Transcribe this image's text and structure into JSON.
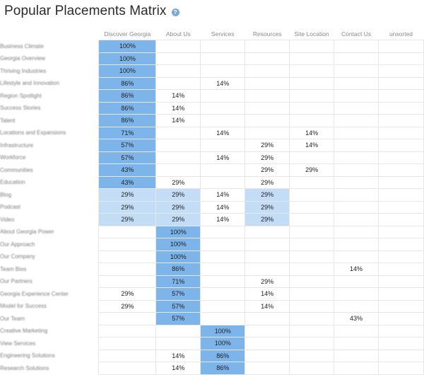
{
  "header": {
    "title": "Popular Placements Matrix",
    "help_icon": "?"
  },
  "colors": {
    "strong": "#7db4ea",
    "light": "#c4ddf7",
    "grid": "#e7e7e7"
  },
  "columns": [
    "Discover Georgia",
    "About Us",
    "Services",
    "Resources",
    "Site Location",
    "Contact Us",
    "unsorted"
  ],
  "rows": [
    {
      "label": "Business Climate",
      "cells": [
        {
          "v": "100%",
          "s": "dark"
        },
        {
          "v": "",
          "s": ""
        },
        {
          "v": "",
          "s": ""
        },
        {
          "v": "",
          "s": ""
        },
        {
          "v": "",
          "s": ""
        },
        {
          "v": "",
          "s": ""
        },
        {
          "v": "",
          "s": ""
        }
      ]
    },
    {
      "label": "Georgia Overview",
      "cells": [
        {
          "v": "100%",
          "s": "dark"
        },
        {
          "v": "",
          "s": ""
        },
        {
          "v": "",
          "s": ""
        },
        {
          "v": "",
          "s": ""
        },
        {
          "v": "",
          "s": ""
        },
        {
          "v": "",
          "s": ""
        },
        {
          "v": "",
          "s": ""
        }
      ]
    },
    {
      "label": "Thriving Industries",
      "cells": [
        {
          "v": "100%",
          "s": "dark"
        },
        {
          "v": "",
          "s": ""
        },
        {
          "v": "",
          "s": ""
        },
        {
          "v": "",
          "s": ""
        },
        {
          "v": "",
          "s": ""
        },
        {
          "v": "",
          "s": ""
        },
        {
          "v": "",
          "s": ""
        }
      ]
    },
    {
      "label": "Lifestyle and Innovation",
      "cells": [
        {
          "v": "86%",
          "s": "dark"
        },
        {
          "v": "",
          "s": ""
        },
        {
          "v": "14%",
          "s": ""
        },
        {
          "v": "",
          "s": ""
        },
        {
          "v": "",
          "s": ""
        },
        {
          "v": "",
          "s": ""
        },
        {
          "v": "",
          "s": ""
        }
      ]
    },
    {
      "label": "Region Spotlight",
      "cells": [
        {
          "v": "86%",
          "s": "dark"
        },
        {
          "v": "14%",
          "s": ""
        },
        {
          "v": "",
          "s": ""
        },
        {
          "v": "",
          "s": ""
        },
        {
          "v": "",
          "s": ""
        },
        {
          "v": "",
          "s": ""
        },
        {
          "v": "",
          "s": ""
        }
      ]
    },
    {
      "label": "Success Stories",
      "cells": [
        {
          "v": "86%",
          "s": "dark"
        },
        {
          "v": "14%",
          "s": ""
        },
        {
          "v": "",
          "s": ""
        },
        {
          "v": "",
          "s": ""
        },
        {
          "v": "",
          "s": ""
        },
        {
          "v": "",
          "s": ""
        },
        {
          "v": "",
          "s": ""
        }
      ]
    },
    {
      "label": "Talent",
      "cells": [
        {
          "v": "86%",
          "s": "dark"
        },
        {
          "v": "14%",
          "s": ""
        },
        {
          "v": "",
          "s": ""
        },
        {
          "v": "",
          "s": ""
        },
        {
          "v": "",
          "s": ""
        },
        {
          "v": "",
          "s": ""
        },
        {
          "v": "",
          "s": ""
        }
      ]
    },
    {
      "label": "Locations and Expansions",
      "cells": [
        {
          "v": "71%",
          "s": "dark"
        },
        {
          "v": "",
          "s": ""
        },
        {
          "v": "14%",
          "s": ""
        },
        {
          "v": "",
          "s": ""
        },
        {
          "v": "14%",
          "s": ""
        },
        {
          "v": "",
          "s": ""
        },
        {
          "v": "",
          "s": ""
        }
      ]
    },
    {
      "label": "Infrastructure",
      "cells": [
        {
          "v": "57%",
          "s": "dark"
        },
        {
          "v": "",
          "s": ""
        },
        {
          "v": "",
          "s": ""
        },
        {
          "v": "29%",
          "s": ""
        },
        {
          "v": "14%",
          "s": ""
        },
        {
          "v": "",
          "s": ""
        },
        {
          "v": "",
          "s": ""
        }
      ]
    },
    {
      "label": "Workforce",
      "cells": [
        {
          "v": "57%",
          "s": "dark"
        },
        {
          "v": "",
          "s": ""
        },
        {
          "v": "14%",
          "s": ""
        },
        {
          "v": "29%",
          "s": ""
        },
        {
          "v": "",
          "s": ""
        },
        {
          "v": "",
          "s": ""
        },
        {
          "v": "",
          "s": ""
        }
      ]
    },
    {
      "label": "Communities",
      "cells": [
        {
          "v": "43%",
          "s": "dark"
        },
        {
          "v": "",
          "s": ""
        },
        {
          "v": "",
          "s": ""
        },
        {
          "v": "29%",
          "s": ""
        },
        {
          "v": "29%",
          "s": ""
        },
        {
          "v": "",
          "s": ""
        },
        {
          "v": "",
          "s": ""
        }
      ]
    },
    {
      "label": "Education",
      "cells": [
        {
          "v": "43%",
          "s": "dark"
        },
        {
          "v": "29%",
          "s": ""
        },
        {
          "v": "",
          "s": ""
        },
        {
          "v": "29%",
          "s": ""
        },
        {
          "v": "",
          "s": ""
        },
        {
          "v": "",
          "s": ""
        },
        {
          "v": "",
          "s": ""
        }
      ]
    },
    {
      "label": "Blog",
      "cells": [
        {
          "v": "29%",
          "s": "light"
        },
        {
          "v": "29%",
          "s": "light"
        },
        {
          "v": "14%",
          "s": ""
        },
        {
          "v": "29%",
          "s": "light"
        },
        {
          "v": "",
          "s": ""
        },
        {
          "v": "",
          "s": ""
        },
        {
          "v": "",
          "s": ""
        }
      ]
    },
    {
      "label": "Podcast",
      "cells": [
        {
          "v": "29%",
          "s": "light"
        },
        {
          "v": "29%",
          "s": "light"
        },
        {
          "v": "14%",
          "s": ""
        },
        {
          "v": "29%",
          "s": "light"
        },
        {
          "v": "",
          "s": ""
        },
        {
          "v": "",
          "s": ""
        },
        {
          "v": "",
          "s": ""
        }
      ]
    },
    {
      "label": "Video",
      "cells": [
        {
          "v": "29%",
          "s": "light"
        },
        {
          "v": "29%",
          "s": "light"
        },
        {
          "v": "14%",
          "s": ""
        },
        {
          "v": "29%",
          "s": "light"
        },
        {
          "v": "",
          "s": ""
        },
        {
          "v": "",
          "s": ""
        },
        {
          "v": "",
          "s": ""
        }
      ]
    },
    {
      "label": "About Georgia Power",
      "cells": [
        {
          "v": "",
          "s": ""
        },
        {
          "v": "100%",
          "s": "dark"
        },
        {
          "v": "",
          "s": ""
        },
        {
          "v": "",
          "s": ""
        },
        {
          "v": "",
          "s": ""
        },
        {
          "v": "",
          "s": ""
        },
        {
          "v": "",
          "s": ""
        }
      ]
    },
    {
      "label": "Our Approach",
      "cells": [
        {
          "v": "",
          "s": ""
        },
        {
          "v": "100%",
          "s": "dark"
        },
        {
          "v": "",
          "s": ""
        },
        {
          "v": "",
          "s": ""
        },
        {
          "v": "",
          "s": ""
        },
        {
          "v": "",
          "s": ""
        },
        {
          "v": "",
          "s": ""
        }
      ]
    },
    {
      "label": "Our Company",
      "cells": [
        {
          "v": "",
          "s": ""
        },
        {
          "v": "100%",
          "s": "dark"
        },
        {
          "v": "",
          "s": ""
        },
        {
          "v": "",
          "s": ""
        },
        {
          "v": "",
          "s": ""
        },
        {
          "v": "",
          "s": ""
        },
        {
          "v": "",
          "s": ""
        }
      ]
    },
    {
      "label": "Team Bios",
      "cells": [
        {
          "v": "",
          "s": ""
        },
        {
          "v": "86%",
          "s": "dark"
        },
        {
          "v": "",
          "s": ""
        },
        {
          "v": "",
          "s": ""
        },
        {
          "v": "",
          "s": ""
        },
        {
          "v": "14%",
          "s": ""
        },
        {
          "v": "",
          "s": ""
        }
      ]
    },
    {
      "label": "Our Partners",
      "cells": [
        {
          "v": "",
          "s": ""
        },
        {
          "v": "71%",
          "s": "dark"
        },
        {
          "v": "",
          "s": ""
        },
        {
          "v": "29%",
          "s": ""
        },
        {
          "v": "",
          "s": ""
        },
        {
          "v": "",
          "s": ""
        },
        {
          "v": "",
          "s": ""
        }
      ]
    },
    {
      "label": "Georgia Experience Center",
      "cells": [
        {
          "v": "29%",
          "s": ""
        },
        {
          "v": "57%",
          "s": "dark"
        },
        {
          "v": "",
          "s": ""
        },
        {
          "v": "14%",
          "s": ""
        },
        {
          "v": "",
          "s": ""
        },
        {
          "v": "",
          "s": ""
        },
        {
          "v": "",
          "s": ""
        }
      ]
    },
    {
      "label": "Model for Success",
      "cells": [
        {
          "v": "29%",
          "s": ""
        },
        {
          "v": "57%",
          "s": "dark"
        },
        {
          "v": "",
          "s": ""
        },
        {
          "v": "14%",
          "s": ""
        },
        {
          "v": "",
          "s": ""
        },
        {
          "v": "",
          "s": ""
        },
        {
          "v": "",
          "s": ""
        }
      ]
    },
    {
      "label": "Our Team",
      "cells": [
        {
          "v": "",
          "s": ""
        },
        {
          "v": "57%",
          "s": "dark"
        },
        {
          "v": "",
          "s": ""
        },
        {
          "v": "",
          "s": ""
        },
        {
          "v": "",
          "s": ""
        },
        {
          "v": "43%",
          "s": ""
        },
        {
          "v": "",
          "s": ""
        }
      ]
    },
    {
      "label": "Creative Marketing",
      "cells": [
        {
          "v": "",
          "s": ""
        },
        {
          "v": "",
          "s": ""
        },
        {
          "v": "100%",
          "s": "dark"
        },
        {
          "v": "",
          "s": ""
        },
        {
          "v": "",
          "s": ""
        },
        {
          "v": "",
          "s": ""
        },
        {
          "v": "",
          "s": ""
        }
      ]
    },
    {
      "label": "View Services",
      "cells": [
        {
          "v": "",
          "s": ""
        },
        {
          "v": "",
          "s": ""
        },
        {
          "v": "100%",
          "s": "dark"
        },
        {
          "v": "",
          "s": ""
        },
        {
          "v": "",
          "s": ""
        },
        {
          "v": "",
          "s": ""
        },
        {
          "v": "",
          "s": ""
        }
      ]
    },
    {
      "label": "Engineering Solutions",
      "cells": [
        {
          "v": "",
          "s": ""
        },
        {
          "v": "14%",
          "s": ""
        },
        {
          "v": "86%",
          "s": "dark"
        },
        {
          "v": "",
          "s": ""
        },
        {
          "v": "",
          "s": ""
        },
        {
          "v": "",
          "s": ""
        },
        {
          "v": "",
          "s": ""
        }
      ]
    },
    {
      "label": "Research Solutions",
      "cells": [
        {
          "v": "",
          "s": ""
        },
        {
          "v": "14%",
          "s": ""
        },
        {
          "v": "86%",
          "s": "dark"
        },
        {
          "v": "",
          "s": ""
        },
        {
          "v": "",
          "s": ""
        },
        {
          "v": "",
          "s": ""
        },
        {
          "v": "",
          "s": ""
        }
      ]
    }
  ]
}
